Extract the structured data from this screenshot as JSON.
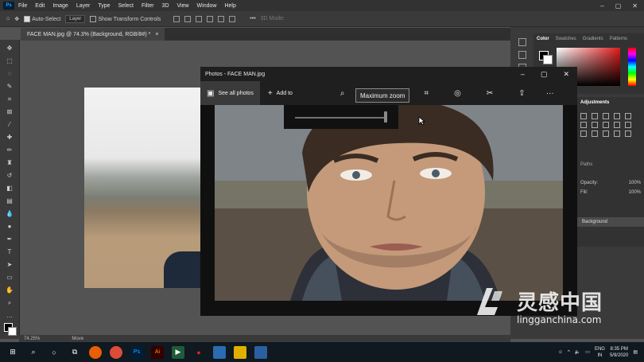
{
  "photoshop": {
    "menu": [
      "File",
      "Edit",
      "Image",
      "Layer",
      "Type",
      "Select",
      "Filter",
      "3D",
      "View",
      "Window",
      "Help"
    ],
    "logo": "Ps",
    "options": {
      "auto_select_label": "Auto-Select",
      "auto_select_value": "Layer",
      "show_transform_label": "Show Transform Controls",
      "mode_3d_label": "3D Mode:"
    },
    "doc_tab": "FACE MAN.jpg @ 74.3% (Background, RGB/8#) *",
    "doc_tab_close": "×",
    "status": {
      "zoom": "74.25%",
      "tool": "Move"
    },
    "panels": {
      "color_tabs": [
        "Color",
        "Swatches",
        "Gradients",
        "Patterns"
      ],
      "adjustments_tab": "Adjustments",
      "layers_tabs": [
        "Paths"
      ],
      "opacity_label": "Opacity:",
      "opacity_value": "100%",
      "fill_label": "Fill:",
      "fill_value": "100%",
      "background_layer": "Background"
    }
  },
  "photos_app": {
    "title": "Photos - FACE MAN.jpg",
    "see_all_label": "See all photos",
    "add_to_label": "Add to",
    "tooltip": "Maximum zoom",
    "zoom_level": 1.0
  },
  "taskbar": {
    "lang_top": "ENG",
    "lang_bottom": "IN",
    "time": "8:35 PM",
    "date": "5/9/2020"
  },
  "watermark": {
    "text": "灵感中国",
    "url": "lingganchina.com"
  }
}
